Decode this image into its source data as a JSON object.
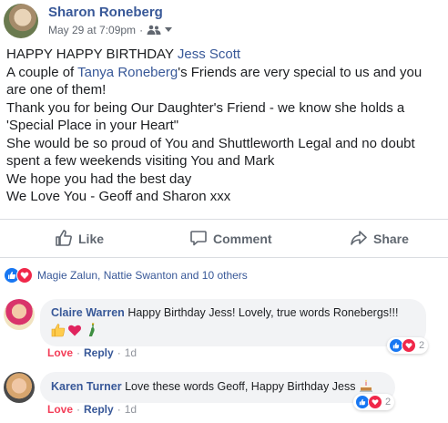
{
  "post": {
    "author": "Sharon Roneberg",
    "timestamp": "May 29 at 7:09pm",
    "privacy_icon": "friends-icon",
    "body": {
      "line1_prefix": "HAPPY HAPPY BIRTHDAY ",
      "line1_tag": "Jess Scott",
      "line2_prefix": "A couple of ",
      "line2_tag": "Tanya Roneberg",
      "line2_suffix": "'s Friends are very special to us and you are one of them!",
      "line3": "Thank you for being Our Daughter's Friend - we know she holds a 'Special Place in your Heart\"",
      "line4": "She would be so proud of You and Shuttleworth Legal and no doubt spent a few weekends visiting You and Mark",
      "line5": "We hope you had the best day",
      "line6": "We Love You - Geoff and Sharon xxx"
    }
  },
  "actions": {
    "like": "Like",
    "comment": "Comment",
    "share": "Share"
  },
  "reactions_summary": "Magie Zalun, Nattie Swanton and 10 others",
  "comments": [
    {
      "name": "Claire Warren",
      "text": "Happy Birthday Jess! Lovely, true words Ronebergs!!!",
      "emojis": [
        "thumbs-up-icon",
        "heart-icon",
        "bottle-icon"
      ],
      "love": "Love",
      "reply": "Reply",
      "time": "1d",
      "reaction_count": "2"
    },
    {
      "name": "Karen Turner",
      "text": "Love these words Geoff, Happy Birthday Jess",
      "emojis": [
        "cake-icon"
      ],
      "love": "Love",
      "reply": "Reply",
      "time": "1d",
      "reaction_count": "2"
    }
  ],
  "colors": {
    "link": "#385898",
    "love": "#f33e58",
    "like_blue": "#1877f2",
    "secondary_text": "#616770"
  }
}
